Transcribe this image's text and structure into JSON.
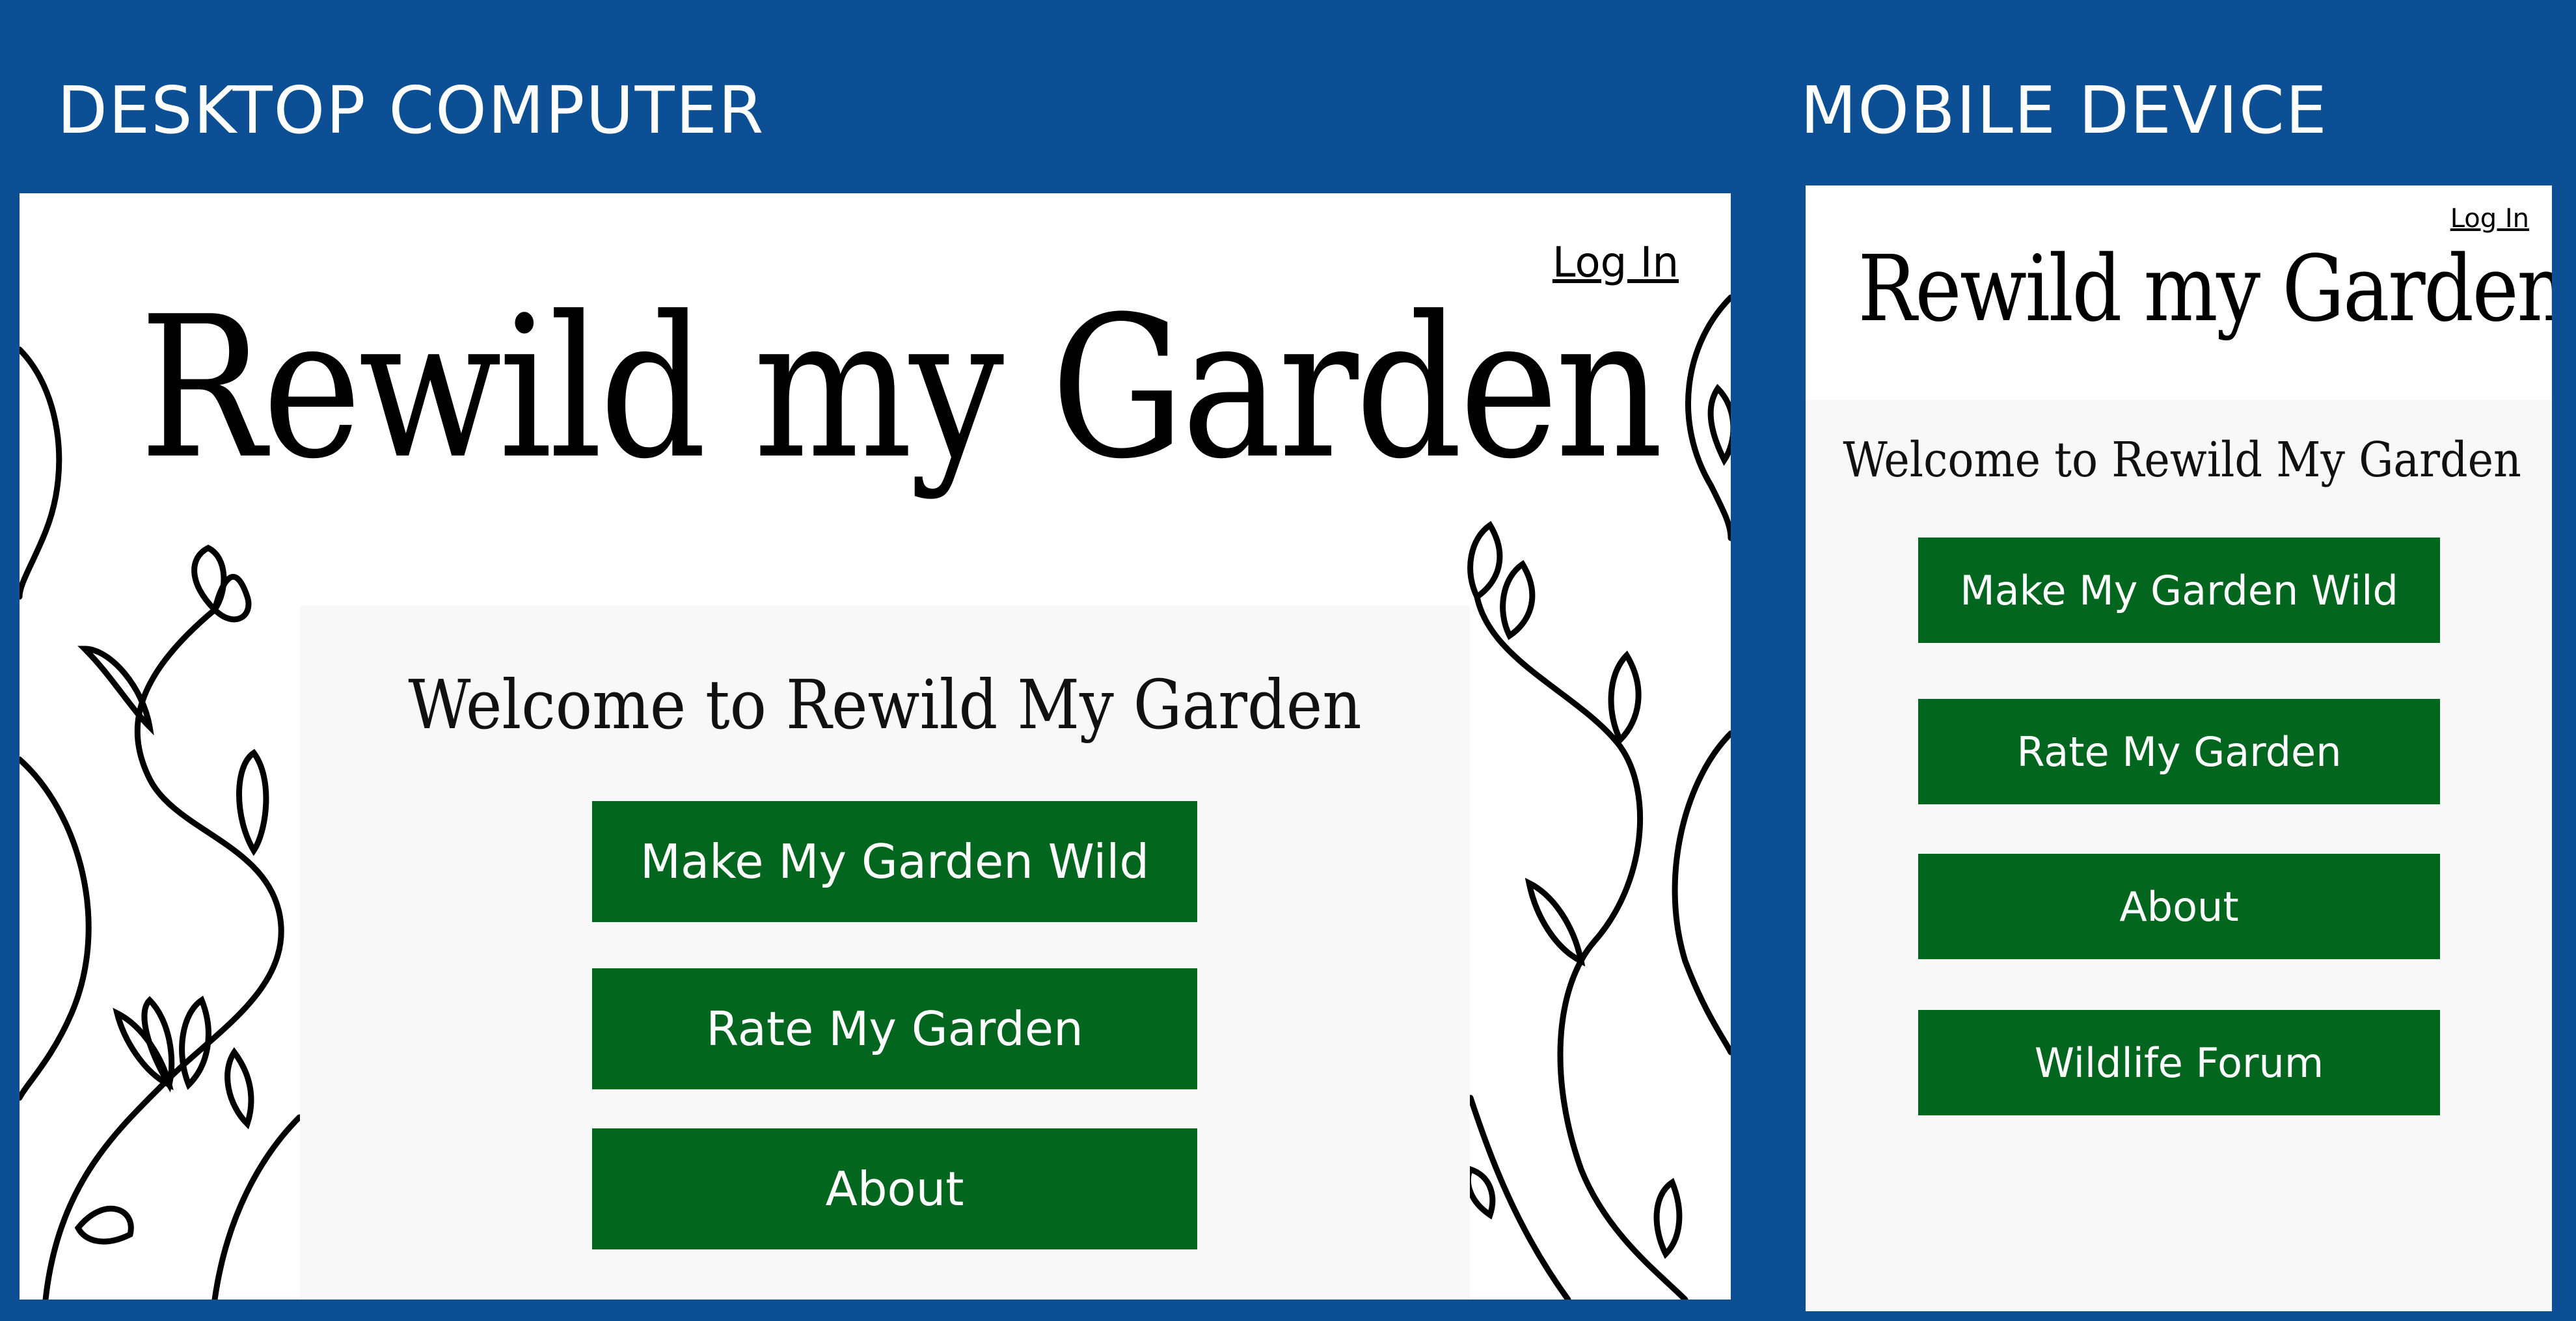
{
  "labels": {
    "desktop": "DESKTOP COMPUTER",
    "mobile": "MOBILE DEVICE"
  },
  "colors": {
    "background": "#0d4f94",
    "button": "#03661f",
    "panel": "#f8f8f8"
  },
  "desktop": {
    "login": "Log In",
    "title": "Rewild my Garden",
    "welcome": "Welcome to Rewild My Garden",
    "buttons": [
      {
        "label": "Make My Garden Wild"
      },
      {
        "label": "Rate My Garden"
      },
      {
        "label": "About"
      }
    ]
  },
  "mobile": {
    "login": "Log In",
    "title": "Rewild my Garden",
    "welcome": "Welcome to Rewild My Garden",
    "buttons": [
      {
        "label": "Make My Garden Wild"
      },
      {
        "label": "Rate My Garden"
      },
      {
        "label": "About"
      },
      {
        "label": "Wildlife Forum"
      }
    ]
  }
}
